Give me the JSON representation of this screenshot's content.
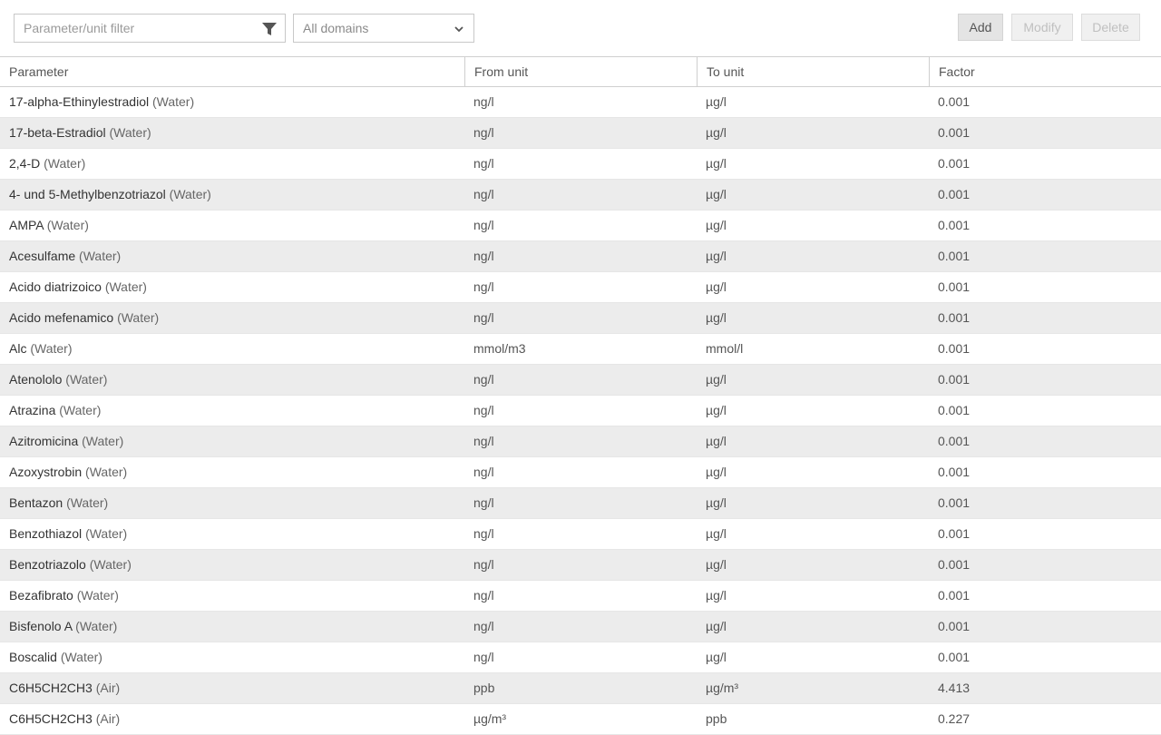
{
  "toolbar": {
    "filter_placeholder": "Parameter/unit filter",
    "domain_value": "All domains",
    "add_label": "Add",
    "modify_label": "Modify",
    "delete_label": "Delete"
  },
  "columns": [
    "Parameter",
    "From unit",
    "To unit",
    "Factor"
  ],
  "rows": [
    {
      "parameter": "17-alpha-Ethinylestradiol",
      "domain": "(Water)",
      "from": "ng/l",
      "to": "µg/l",
      "factor": "0.001"
    },
    {
      "parameter": "17-beta-Estradiol",
      "domain": "(Water)",
      "from": "ng/l",
      "to": "µg/l",
      "factor": "0.001"
    },
    {
      "parameter": "2,4-D",
      "domain": "(Water)",
      "from": "ng/l",
      "to": "µg/l",
      "factor": "0.001"
    },
    {
      "parameter": "4- und 5-Methylbenzotriazol",
      "domain": "(Water)",
      "from": "ng/l",
      "to": "µg/l",
      "factor": "0.001"
    },
    {
      "parameter": "AMPA",
      "domain": "(Water)",
      "from": "ng/l",
      "to": "µg/l",
      "factor": "0.001"
    },
    {
      "parameter": "Acesulfame",
      "domain": "(Water)",
      "from": "ng/l",
      "to": "µg/l",
      "factor": "0.001"
    },
    {
      "parameter": "Acido diatrizoico",
      "domain": "(Water)",
      "from": "ng/l",
      "to": "µg/l",
      "factor": "0.001"
    },
    {
      "parameter": "Acido mefenamico",
      "domain": "(Water)",
      "from": "ng/l",
      "to": "µg/l",
      "factor": "0.001"
    },
    {
      "parameter": "Alc",
      "domain": "(Water)",
      "from": "mmol/m3",
      "to": "mmol/l",
      "factor": "0.001"
    },
    {
      "parameter": "Atenololo",
      "domain": "(Water)",
      "from": "ng/l",
      "to": "µg/l",
      "factor": "0.001"
    },
    {
      "parameter": "Atrazina",
      "domain": "(Water)",
      "from": "ng/l",
      "to": "µg/l",
      "factor": "0.001"
    },
    {
      "parameter": "Azitromicina",
      "domain": "(Water)",
      "from": "ng/l",
      "to": "µg/l",
      "factor": "0.001"
    },
    {
      "parameter": "Azoxystrobin",
      "domain": "(Water)",
      "from": "ng/l",
      "to": "µg/l",
      "factor": "0.001"
    },
    {
      "parameter": "Bentazon",
      "domain": "(Water)",
      "from": "ng/l",
      "to": "µg/l",
      "factor": "0.001"
    },
    {
      "parameter": "Benzothiazol",
      "domain": "(Water)",
      "from": "ng/l",
      "to": "µg/l",
      "factor": "0.001"
    },
    {
      "parameter": "Benzotriazolo",
      "domain": "(Water)",
      "from": "ng/l",
      "to": "µg/l",
      "factor": "0.001"
    },
    {
      "parameter": "Bezafibrato",
      "domain": "(Water)",
      "from": "ng/l",
      "to": "µg/l",
      "factor": "0.001"
    },
    {
      "parameter": "Bisfenolo A",
      "domain": "(Water)",
      "from": "ng/l",
      "to": "µg/l",
      "factor": "0.001"
    },
    {
      "parameter": "Boscalid",
      "domain": "(Water)",
      "from": "ng/l",
      "to": "µg/l",
      "factor": "0.001"
    },
    {
      "parameter": "C6H5CH2CH3",
      "domain": "(Air)",
      "from": "ppb",
      "to": "µg/m³",
      "factor": "4.413"
    },
    {
      "parameter": "C6H5CH2CH3",
      "domain": "(Air)",
      "from": "µg/m³",
      "to": "ppb",
      "factor": "0.227"
    }
  ]
}
